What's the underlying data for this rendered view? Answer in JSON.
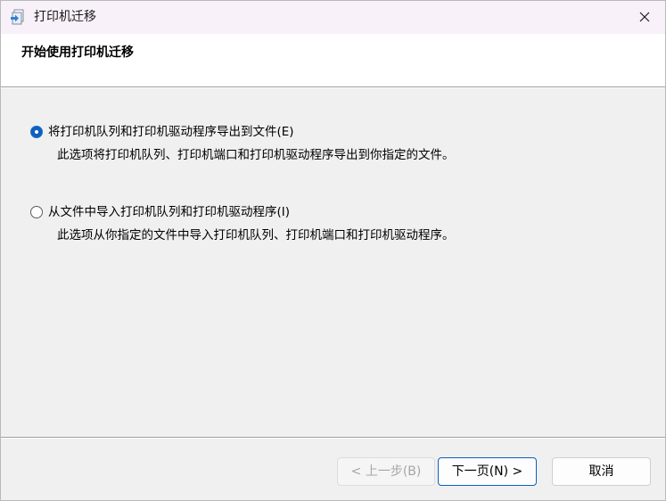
{
  "window": {
    "title": "打印机迁移",
    "close_icon": "close-icon",
    "app_icon": "printer-migration-icon"
  },
  "header": {
    "title": "开始使用打印机迁移"
  },
  "options": [
    {
      "label": "将打印机队列和打印机驱动程序导出到文件(E)",
      "description": "此选项将打印机队列、打印机端口和打印机驱动程序导出到你指定的文件。",
      "selected": true
    },
    {
      "label": "从文件中导入打印机队列和打印机驱动程序(I)",
      "description": "此选项从你指定的文件中导入打印机队列、打印机端口和打印机驱动程序。",
      "selected": false
    }
  ],
  "buttons": {
    "back": "< 上一步(B)",
    "next": "下一页(N) >",
    "cancel": "取消"
  },
  "colors": {
    "accent": "#0f5fbf",
    "window_bg": "#f0f0f0",
    "titlebar_bg": "#f9f1f9"
  }
}
